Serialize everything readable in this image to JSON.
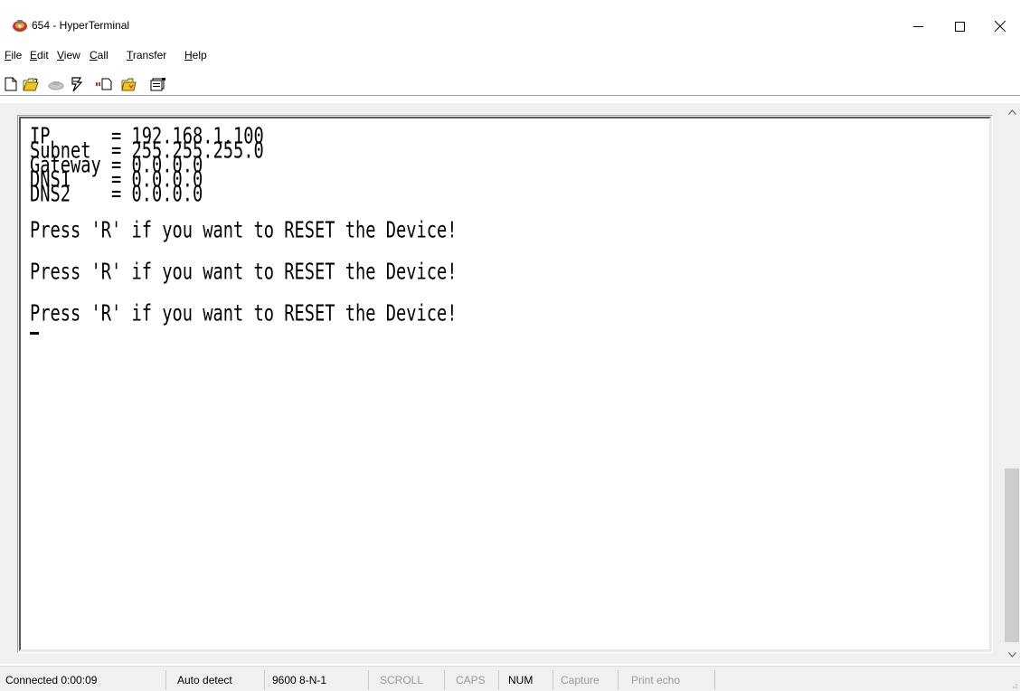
{
  "window": {
    "title": "654 - HyperTerminal",
    "app_icon": "hyperterminal-icon",
    "controls": {
      "minimize_icon": "minimize-icon",
      "maximize_icon": "maximize-icon",
      "close_icon": "close-icon"
    }
  },
  "menu": {
    "file": {
      "key": "F",
      "rest": "ile"
    },
    "edit": {
      "key": "E",
      "rest": "dit"
    },
    "view": {
      "key": "V",
      "rest": "iew"
    },
    "call": {
      "key": "C",
      "rest": "all"
    },
    "transfer": {
      "key": "T",
      "rest": "ransfer"
    },
    "help": {
      "key": "H",
      "rest": "elp"
    }
  },
  "toolbar": {
    "buttons": [
      "new-icon",
      "open-icon",
      "disconnect-icon",
      "call-icon",
      "send-icon",
      "receive-icon",
      "properties-icon"
    ]
  },
  "terminal": {
    "lines": [
      "IP      = 192.168.1.100",
      "Subnet  = 255.255.255.0",
      "Gateway = 0.0.0.0",
      "DNS1    = 0.0.0.0",
      "DNS2    = 0.0.0.0",
      "Press 'R' if you want to RESET the Device!",
      "Press 'R' if you want to RESET the Device!",
      "Press 'R' if you want to RESET the Device!"
    ]
  },
  "status": {
    "connected": "Connected 0:00:09",
    "detect": "Auto detect",
    "settings": "9600 8-N-1",
    "scroll": "SCROLL",
    "caps": "CAPS",
    "num": "NUM",
    "capture": "Capture",
    "print_echo": "Print echo"
  }
}
